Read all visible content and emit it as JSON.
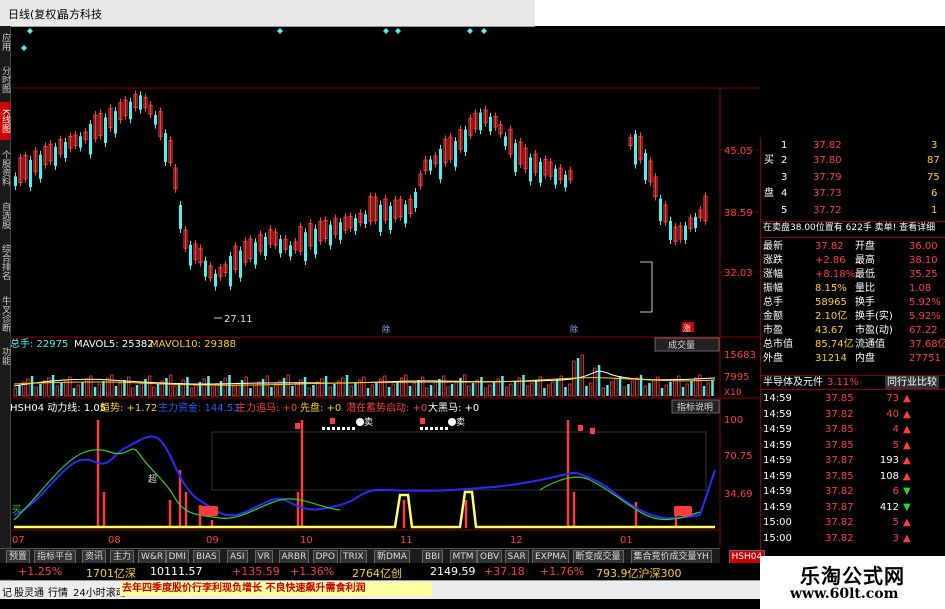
{
  "title_bar": {
    "title": "日线(复权)",
    "stock_name": "晶方科技"
  },
  "left_tabs": [
    "应用",
    "分时图",
    "K线图",
    "个股资料",
    "自选股",
    "综合排名",
    "牛叉诊断",
    "功能"
  ],
  "price_chart": {
    "axis_labels": [
      "45.05",
      "38.59",
      "32.03"
    ],
    "low_label": "27.11",
    "markers": [
      "除",
      "除",
      "涨"
    ]
  },
  "volume_panel": {
    "title": "总手: 22975",
    "mavol5": "MAVOL5: 25382",
    "mavol10": "MAVOL10: 29388",
    "button": "成交量",
    "axis_labels": [
      "15683",
      "7995",
      "X10"
    ]
  },
  "indicator_panel": {
    "name": "HSH04 动力线: 1.05",
    "trend": "趋势: +1.72",
    "power": "主力资金: 144.53",
    "main_buy": "主力追马: +0",
    "xianpan": "先盘: +0",
    "qianli": "潜在蓄势启动: +0",
    "heima": "大黑马: +0",
    "button": "指标说明",
    "axis_labels": [
      "100",
      "70.75",
      "34.69"
    ],
    "buy_label": "买",
    "chao_label": "超",
    "sell_label": "卖"
  },
  "x_axis_labels": [
    "07",
    "08",
    "09",
    "10",
    "11",
    "12",
    "01"
  ],
  "order_book": {
    "sell_label": "卖",
    "buy_label": "买",
    "pan_label": "盘",
    "rows": [
      {
        "n": "1",
        "price": "37.82",
        "vol": "3"
      },
      {
        "n": "2",
        "price": "37.80",
        "vol": "87"
      },
      {
        "n": "3",
        "price": "37.79",
        "vol": "75"
      },
      {
        "n": "4",
        "price": "37.73",
        "vol": "6"
      },
      {
        "n": "5",
        "price": "37.72",
        "vol": "1"
      }
    ],
    "info_line": "在卖盘38.00位置有 622手 卖单! 查看详细"
  },
  "quote": [
    {
      "k1": "最新",
      "v1": "37.82",
      "k2": "开盘",
      "v2": "36.00"
    },
    {
      "k1": "涨跌",
      "v1": "+2.86",
      "k2": "最高",
      "v2": "38.10"
    },
    {
      "k1": "涨幅",
      "v1": "+8.18%",
      "k2": "最低",
      "v2": "35.25"
    },
    {
      "k1": "振幅",
      "v1": "8.15%",
      "k2": "量比",
      "v2": "1.08"
    },
    {
      "k1": "总手",
      "v1": "58965",
      "k2": "换手",
      "v2": "5.92%"
    },
    {
      "k1": "金额",
      "v1": "2.10亿",
      "k2": "换手(实)",
      "v2": "5.92%"
    },
    {
      "k1": "市盈",
      "v1": "43.67",
      "k2": "市盈(动)",
      "v2": "67.22"
    },
    {
      "k1": "总市值",
      "v1": "85.74亿",
      "k2": "流通值",
      "v2": "37.68亿"
    },
    {
      "k1": "外盘",
      "v1": "31214",
      "k2": "内盘",
      "v2": "27751"
    }
  ],
  "sector": {
    "name": "半导体及元件",
    "pct": "3.11%",
    "btn": "同行业比较"
  },
  "ticks": [
    {
      "time": "14:59",
      "price": "37.85",
      "vol": "73",
      "dir": "up"
    },
    {
      "time": "14:59",
      "price": "37.82",
      "vol": "40",
      "dir": "up"
    },
    {
      "time": "14:59",
      "price": "37.85",
      "vol": "4",
      "dir": "up"
    },
    {
      "time": "14:59",
      "price": "37.85",
      "vol": "5",
      "dir": "up"
    },
    {
      "time": "14:59",
      "price": "37.87",
      "vol": "193",
      "dir": "up"
    },
    {
      "time": "14:59",
      "price": "37.85",
      "vol": "108",
      "dir": "up"
    },
    {
      "time": "14:59",
      "price": "37.82",
      "vol": "6",
      "dir": "down"
    },
    {
      "time": "14:59",
      "price": "37.87",
      "vol": "412",
      "dir": "down"
    },
    {
      "time": "15:00",
      "price": "37.82",
      "vol": "5",
      "dir": "up"
    },
    {
      "time": "15:00",
      "price": "37.82",
      "vol": "3",
      "dir": "up"
    }
  ],
  "bottom_tabs": [
    "预置",
    "指标平台",
    "资讯",
    "主力",
    "W&R",
    "DMI",
    "BIAS",
    "ASI",
    "VR",
    "ARBR",
    "DPO",
    "TRIX",
    "新DMA",
    "BBI",
    "MTM",
    "OBV",
    "SAR",
    "EXPMA",
    "断变成交量",
    "集合竞价成交量YH",
    "HSH04"
  ],
  "index_bar": [
    {
      "text": "+1.25%",
      "color": "red"
    },
    {
      "text": "1701亿深",
      "color": "yel"
    },
    {
      "text": "10111.57",
      "color": "wht"
    },
    {
      "text": "+135.59",
      "color": "red"
    },
    {
      "text": "+1.36%",
      "color": "red"
    },
    {
      "text": "2764亿创",
      "color": "yel"
    },
    {
      "text": "2149.59",
      "color": "wht"
    },
    {
      "text": "+37.18",
      "color": "red"
    },
    {
      "text": "+1.76%",
      "color": "red"
    },
    {
      "text": "793.9亿沪深300",
      "color": "yel"
    }
  ],
  "status_bar": {
    "items": [
      "记",
      "股灵通",
      "行情",
      "24小时滚动"
    ],
    "news": "去年四季度股价行李利现负增长  不良快速飙升需食利润"
  },
  "watermark": {
    "line1": "乐淘公式网",
    "line2": "www.60lt.com"
  },
  "colors": {
    "up": "#ff3c3c",
    "down": "#4cf0f0",
    "bg": "#000000",
    "frame": "#800000"
  }
}
